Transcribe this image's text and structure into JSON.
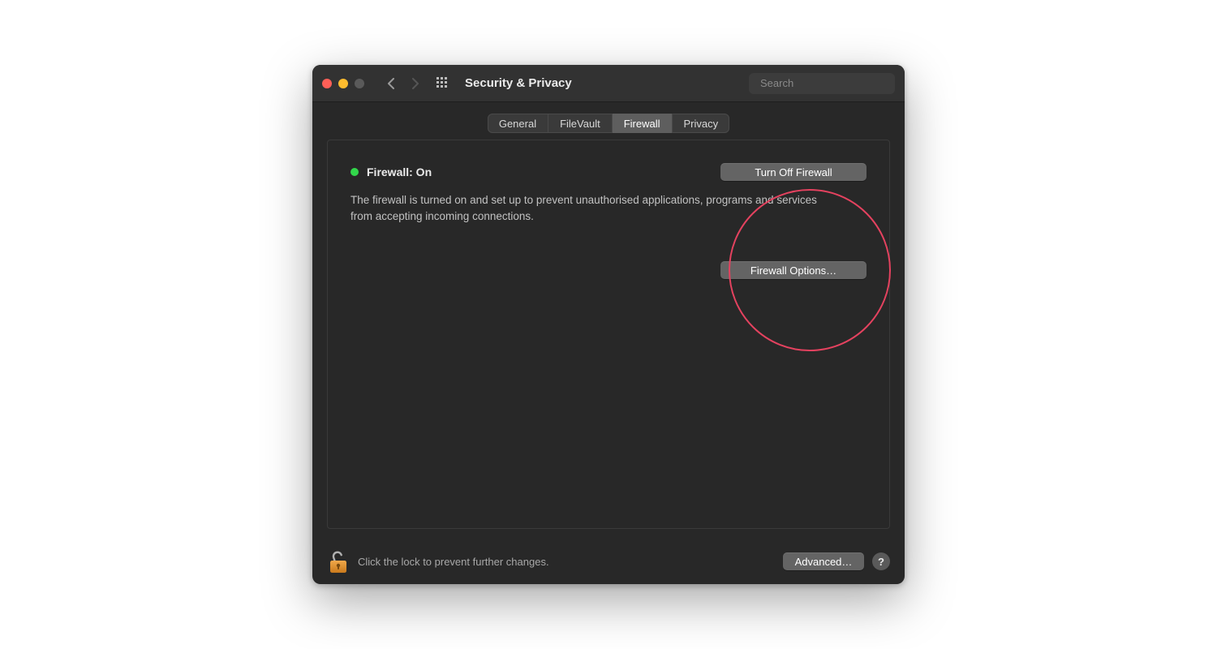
{
  "window": {
    "title": "Security & Privacy"
  },
  "search": {
    "placeholder": "Search"
  },
  "tabs": [
    {
      "label": "General",
      "active": false
    },
    {
      "label": "FileVault",
      "active": false
    },
    {
      "label": "Firewall",
      "active": true
    },
    {
      "label": "Privacy",
      "active": false
    }
  ],
  "firewall": {
    "status_label": "Firewall: On",
    "status_color": "#32d74b",
    "toggle_button": "Turn Off Firewall",
    "description": "The firewall is turned on and set up to prevent unauthorised applications, programs and services from accepting incoming connections.",
    "options_button": "Firewall Options…"
  },
  "footer": {
    "lock_text": "Click the lock to prevent further changes.",
    "advanced_button": "Advanced…",
    "help_label": "?"
  },
  "annotation": {
    "color": "#e4425f"
  }
}
